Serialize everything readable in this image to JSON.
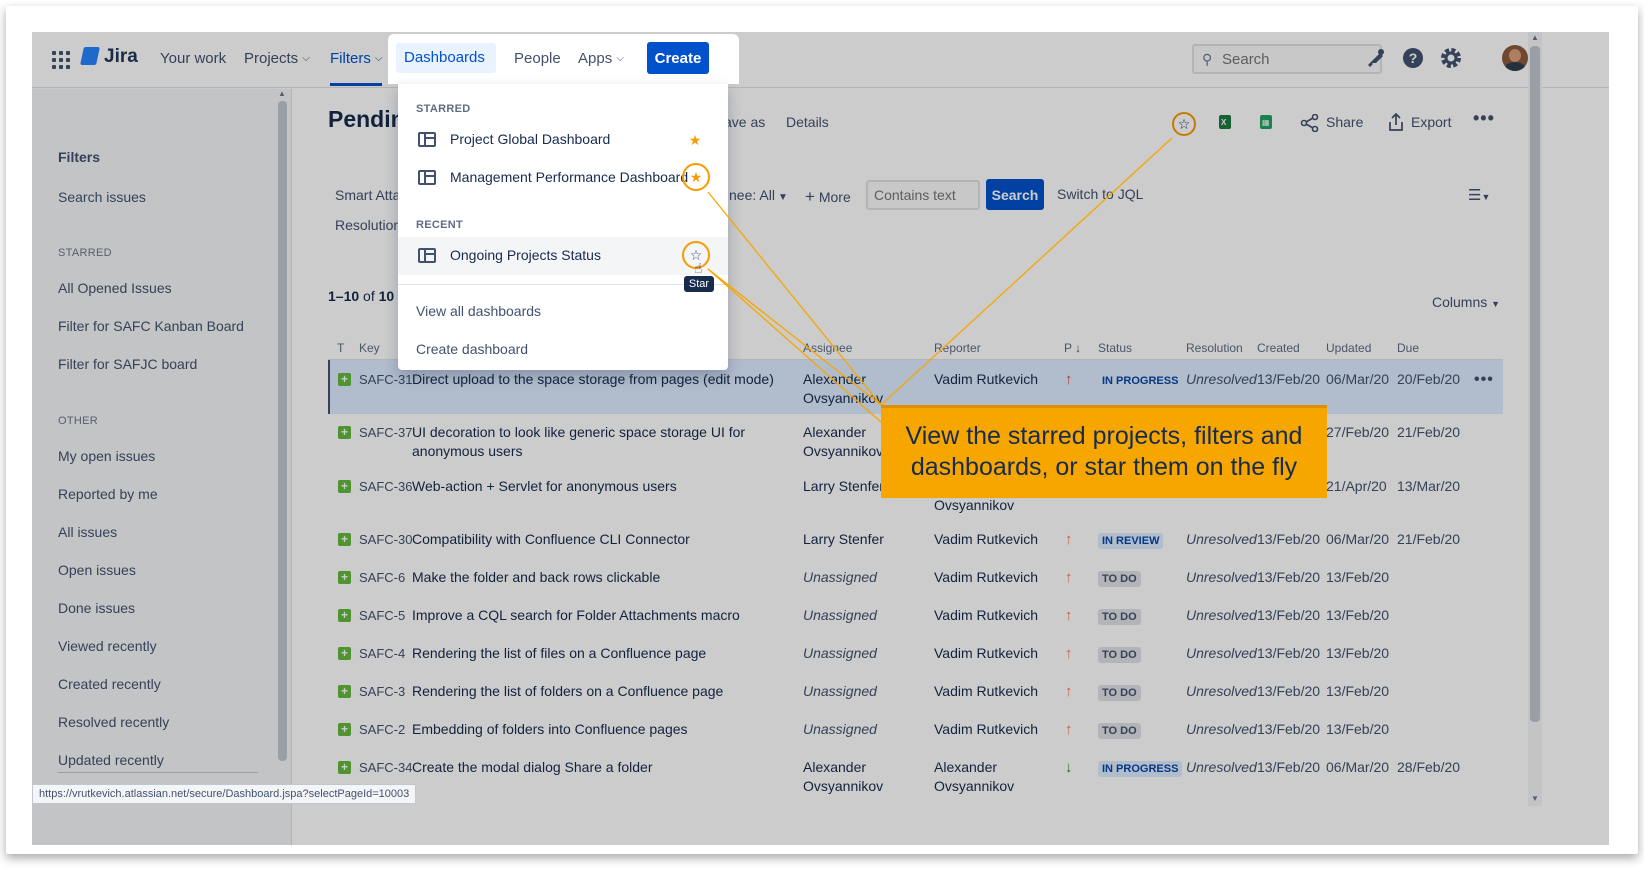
{
  "topbar": {
    "brand": "Jira",
    "nav": {
      "your_work": "Your work",
      "projects": "Projects",
      "filters": "Filters",
      "dashboards": "Dashboards",
      "people": "People",
      "apps": "Apps",
      "create": "Create"
    },
    "search_placeholder": "Search",
    "icons": [
      "app-switcher-icon",
      "notifications-icon",
      "help-icon",
      "settings-icon",
      "avatar"
    ]
  },
  "sidebar": {
    "title": "Filters",
    "search_issues": "Search issues",
    "starred_label": "STARRED",
    "starred": [
      "All Opened Issues",
      "Filter for SAFC Kanban Board",
      "Filter for SAFJC board"
    ],
    "other_label": "OTHER",
    "other": [
      "My open issues",
      "Reported by me",
      "All issues",
      "Open issues",
      "Done issues",
      "Viewed recently",
      "Created recently",
      "Resolved recently",
      "Updated recently"
    ]
  },
  "main": {
    "title": "Pendin",
    "save_as": "ave as",
    "details": "Details",
    "share": "Share",
    "export": "Export",
    "filter_bar": {
      "smart_attachments": "Smart Atta",
      "resolution": "Resolution",
      "assignee": "nee: All",
      "more": "More",
      "contains_placeholder": "Contains text",
      "search": "Search",
      "switch_jql": "Switch to JQL"
    },
    "count": {
      "range": "1–10",
      "of": "of",
      "total": "10"
    },
    "columns": "Columns"
  },
  "table": {
    "headers": {
      "t": "T",
      "key": "Key",
      "assignee": "Assignee",
      "reporter": "Reporter",
      "p": "P",
      "status": "Status",
      "resolution": "Resolution",
      "created": "Created",
      "updated": "Updated",
      "due": "Due"
    },
    "rows": [
      {
        "key": "SAFC-31",
        "summary": "Direct upload to the space storage from pages (edit mode)",
        "assignee": "Alexander Ovsyannikov",
        "reporter": "Vadim Rutkevich",
        "priority": "high",
        "status": "IN PROGRESS",
        "resolution": "Unresolved",
        "created": "13/Feb/20",
        "updated": "06/Mar/20",
        "due": "20/Feb/20"
      },
      {
        "key": "SAFC-37",
        "summary": "UI decoration to look like generic space storage UI for anonymous users",
        "assignee": "Alexander Ovsyannikov",
        "reporter": "",
        "priority": "",
        "status": "",
        "resolution": "",
        "created": "",
        "updated": "27/Feb/20",
        "due": "21/Feb/20"
      },
      {
        "key": "SAFC-36",
        "summary": "Web-action + Servlet for anonymous users",
        "assignee": "Larry Stenfer",
        "reporter": "Ovsyannikov",
        "priority": "",
        "status": "",
        "resolution": "",
        "created": "",
        "updated": "21/Apr/20",
        "due": "13/Mar/20"
      },
      {
        "key": "SAFC-30",
        "summary": "Compatibility with Confluence CLI Connector",
        "assignee": "Larry Stenfer",
        "reporter": "Vadim Rutkevich",
        "priority": "medium",
        "status": "IN REVIEW",
        "resolution": "Unresolved",
        "created": "13/Feb/20",
        "updated": "06/Mar/20",
        "due": "21/Feb/20"
      },
      {
        "key": "SAFC-6",
        "summary": "Make the folder and back rows clickable",
        "assignee": "Unassigned",
        "reporter": "Vadim Rutkevich",
        "priority": "medium",
        "status": "TO DO",
        "resolution": "Unresolved",
        "created": "13/Feb/20",
        "updated": "13/Feb/20",
        "due": ""
      },
      {
        "key": "SAFC-5",
        "summary": "Improve a CQL search for Folder Attachments macro",
        "assignee": "Unassigned",
        "reporter": "Vadim Rutkevich",
        "priority": "medium",
        "status": "TO DO",
        "resolution": "Unresolved",
        "created": "13/Feb/20",
        "updated": "13/Feb/20",
        "due": ""
      },
      {
        "key": "SAFC-4",
        "summary": "Rendering the list of files on a Confluence page",
        "assignee": "Unassigned",
        "reporter": "Vadim Rutkevich",
        "priority": "medium",
        "status": "TO DO",
        "resolution": "Unresolved",
        "created": "13/Feb/20",
        "updated": "13/Feb/20",
        "due": ""
      },
      {
        "key": "SAFC-3",
        "summary": "Rendering the list of folders on a Confluence page",
        "assignee": "Unassigned",
        "reporter": "Vadim Rutkevich",
        "priority": "medium",
        "status": "TO DO",
        "resolution": "Unresolved",
        "created": "13/Feb/20",
        "updated": "13/Feb/20",
        "due": ""
      },
      {
        "key": "SAFC-2",
        "summary": "Embedding of folders into Confluence pages",
        "assignee": "Unassigned",
        "reporter": "Vadim Rutkevich",
        "priority": "medium",
        "status": "TO DO",
        "resolution": "Unresolved",
        "created": "13/Feb/20",
        "updated": "13/Feb/20",
        "due": ""
      },
      {
        "key": "SAFC-34",
        "summary": "Create the modal dialog Share a folder",
        "assignee": "Alexander Ovsyannikov",
        "reporter": "Alexander Ovsyannikov",
        "priority": "low",
        "status": "IN PROGRESS",
        "resolution": "Unresolved",
        "created": "13/Feb/20",
        "updated": "06/Mar/20",
        "due": "28/Feb/20"
      }
    ]
  },
  "dropdown": {
    "starred_label": "STARRED",
    "starred": [
      "Project Global Dashboard",
      "Management Performance Dashboard"
    ],
    "recent_label": "RECENT",
    "recent": [
      "Ongoing Projects Status"
    ],
    "view_all": "View all dashboards",
    "create": "Create dashboard",
    "tooltip": "Star"
  },
  "callout": {
    "line1": "View the starred projects, filters and",
    "line2": "dashboards, or star them on the fly"
  },
  "status_url": "https://vrutkevich.atlassian.net/secure/Dashboard.jspa?selectPageId=10003",
  "colors": {
    "brand_blue": "#0052cc",
    "highlight_orange": "#f7a600",
    "priority_high": "#e5493a",
    "priority_medium": "#ff7452",
    "priority_low": "#2a8735"
  }
}
